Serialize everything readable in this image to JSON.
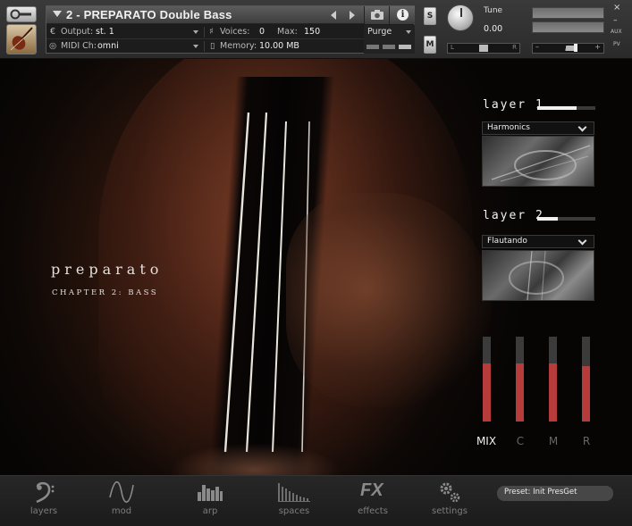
{
  "instrument": {
    "title": "2 - PREPARATO Double Bass",
    "output_label": "Output:",
    "output_value": "st. 1",
    "midi_label": "MIDI Ch:",
    "midi_value": "omni",
    "voices_label": "Voices:",
    "voices_value": "0",
    "max_label": "Max:",
    "max_value": "150",
    "memory_label": "Memory:",
    "memory_value": "10.00 MB",
    "purge_label": "Purge",
    "solo_label": "S",
    "mute_label": "M",
    "info_label": "i"
  },
  "tune": {
    "label": "Tune",
    "value": "0.00"
  },
  "pan": {
    "left_label": "L",
    "right_label": "R"
  },
  "volume": {
    "minus_label": "–",
    "plus_label": "+"
  },
  "window": {
    "close_label": "×",
    "minimize_label": "–",
    "aux_label": "AUX",
    "pv_label": "PV"
  },
  "brand": {
    "name": "preparato",
    "subtitle": "CHAPTER 2: BASS"
  },
  "layers": [
    {
      "title": "layer 1",
      "level": 0.68,
      "articulation": "Harmonics"
    },
    {
      "title": "layer 2",
      "level": 0.36,
      "articulation": "Flautando"
    }
  ],
  "mix": {
    "channels": [
      {
        "label": "MIX",
        "level": 0.68,
        "active": true
      },
      {
        "label": "C",
        "level": 0.68,
        "active": false
      },
      {
        "label": "M",
        "level": 0.68,
        "active": false
      },
      {
        "label": "R",
        "level": 0.65,
        "active": false
      }
    ],
    "bar_color": "#b63c3c"
  },
  "nav": {
    "items": [
      {
        "id": "layers",
        "label": "layers",
        "icon": "bass-clef-icon"
      },
      {
        "id": "mod",
        "label": "mod",
        "icon": "sine-wave-icon"
      },
      {
        "id": "arp",
        "label": "arp",
        "icon": "arp-bars-icon"
      },
      {
        "id": "spaces",
        "label": "spaces",
        "icon": "reverb-decay-icon"
      },
      {
        "id": "effects",
        "label": "effects",
        "icon": "fx-icon",
        "glyph": "FX"
      },
      {
        "id": "settings",
        "label": "settings",
        "icon": "gears-icon"
      }
    ],
    "preset": "Preset: Init PresGet"
  }
}
